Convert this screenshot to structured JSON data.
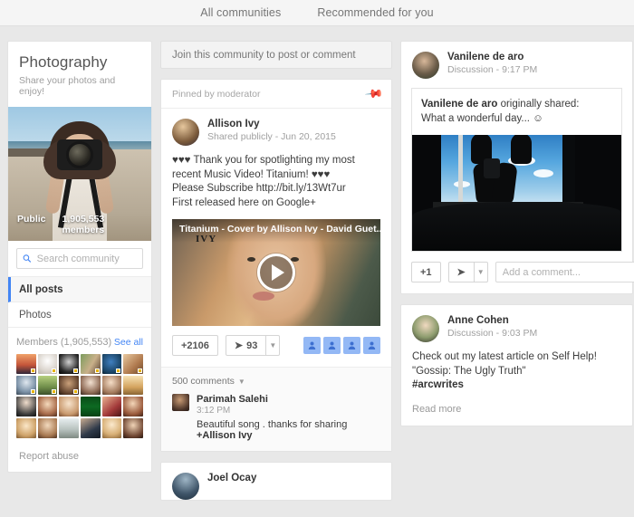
{
  "topnav": {
    "items": [
      {
        "label": "All communities"
      },
      {
        "label": "Recommended for you"
      }
    ]
  },
  "sidebar": {
    "community_title": "Photography",
    "community_tagline": "Share your photos and enjoy!",
    "cover_privacy": "Public",
    "cover_members": "1,905,553 members",
    "search": {
      "placeholder": "Search community",
      "value": ""
    },
    "nav": [
      {
        "label": "All posts",
        "active": true
      },
      {
        "label": "Photos",
        "active": false
      }
    ],
    "members_heading": "Members (1,905,553)",
    "see_all_label": "See all",
    "member_avatar_count": 24,
    "report_abuse_label": "Report abuse"
  },
  "main": {
    "join_banner": "Join this community to post or comment",
    "post": {
      "pinned_label": "Pinned by moderator",
      "pin_icon": "pin-icon",
      "author": "Allison Ivy",
      "meta": "Shared publicly  -  Jun 20, 2015",
      "text_line1": "♥♥♥ Thank you for spotlighting my most recent Music Video! Titanium! ♥♥♥",
      "text_line2": "Please Subscribe http://bit.ly/13Wt7ur",
      "text_line3": "First released here on Google+",
      "video_title": "Titanium - Cover by Allison Ivy - David Guet...",
      "video_watermark": "IVY",
      "plus_one_label": "+2106",
      "share_count": "93",
      "chip_icon": "person-icon",
      "chip_count": 4,
      "comments_count_label": "500 comments",
      "comment": {
        "name": "Parimah Salehi",
        "time": "3:12 PM",
        "text": "Beautiful song . thanks for sharing ",
        "mention": "+Allison Ivy"
      }
    },
    "next_post_author": "Joel Ocay"
  },
  "right": {
    "post1": {
      "author": "Vanilene de aro",
      "meta": "Discussion  -  9:17 PM",
      "reshare_author": "Vanilene de aro",
      "reshare_label": " originally shared:",
      "reshare_text": "What a wonderful day... ☺",
      "plus_one_label": "+1",
      "share_icon": "share-arrow-icon",
      "comment_placeholder": "Add a comment...",
      "comment_value": ""
    },
    "post2": {
      "author": "Anne Cohen",
      "meta": "Discussion  -  9:03 PM",
      "text_line1": "Check out my latest article on Self Help!",
      "text_line2": "\"Gossip: The Ugly Truth\"",
      "hashtag": "#arcwrites",
      "read_more_label": "Read more"
    }
  },
  "colors": {
    "accent_blue": "#4285f4",
    "pin_green": "#2aa84a",
    "chip_blue": "#93b8f5",
    "page_bg": "#e8e8e8"
  }
}
